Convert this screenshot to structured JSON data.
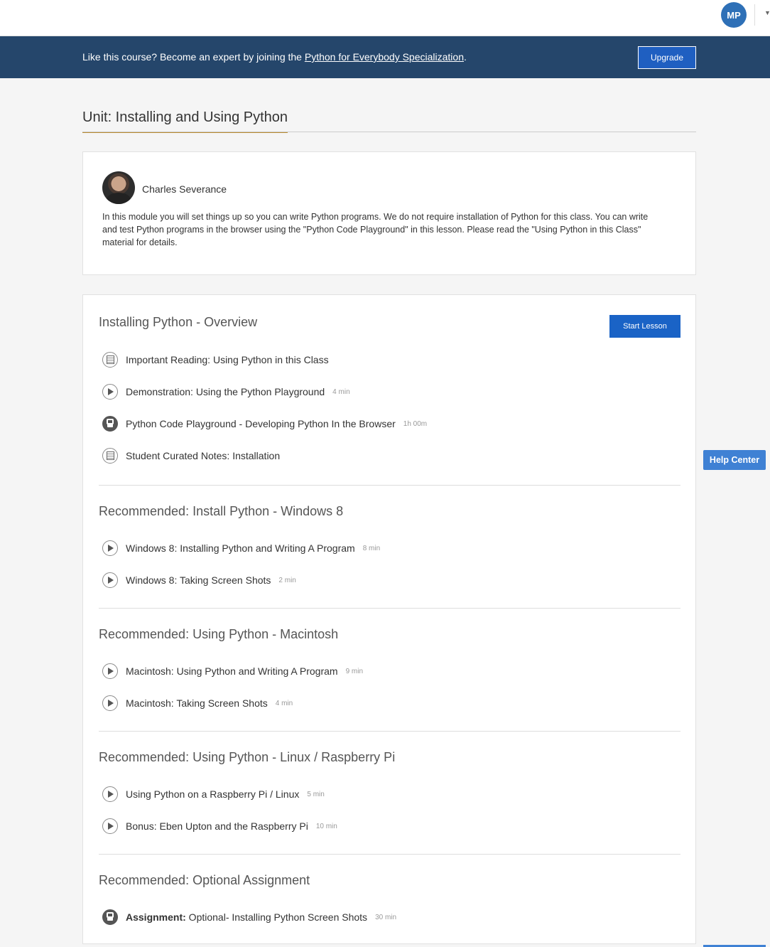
{
  "header": {
    "avatar_initials": "MP"
  },
  "banner": {
    "text_before": "Like this course? Become an expert by joining the ",
    "link_text": "Python for Everybody Specialization",
    "text_after": ".",
    "upgrade_label": "Upgrade"
  },
  "unit": {
    "title": "Unit: Installing and Using Python"
  },
  "intro": {
    "author": "Charles Severance",
    "description": "In this module you will set things up so you can write Python programs. We do not require installation of Python for this class. You can write and test Python programs in the browser using the \"Python Code Playground\" in this lesson. Please read the \"Using Python in this Class\" material for details."
  },
  "lessons": {
    "start_label": "Start Lesson",
    "sections": [
      {
        "title": "Installing Python - Overview",
        "items": [
          {
            "icon": "reading-icon",
            "label": "Important Reading: Using Python in this Class",
            "duration": ""
          },
          {
            "icon": "play-icon",
            "label": "Demonstration: Using the Python Playground",
            "duration": "4 min"
          },
          {
            "icon": "lock-icon",
            "label": "Python Code Playground - Developing Python In the Browser",
            "duration": "1h 00m"
          },
          {
            "icon": "reading-icon",
            "label": "Student Curated Notes: Installation",
            "duration": ""
          }
        ]
      },
      {
        "title": "Recommended: Install Python - Windows 8",
        "items": [
          {
            "icon": "play-icon",
            "label": "Windows 8: Installing Python and Writing A Program",
            "duration": "8 min"
          },
          {
            "icon": "play-icon",
            "label": "Windows 8: Taking Screen Shots",
            "duration": "2 min"
          }
        ]
      },
      {
        "title": "Recommended: Using Python - Macintosh",
        "items": [
          {
            "icon": "play-icon",
            "label": "Macintosh: Using Python and Writing A Program",
            "duration": "9 min"
          },
          {
            "icon": "play-icon",
            "label": "Macintosh: Taking Screen Shots",
            "duration": "4 min"
          }
        ]
      },
      {
        "title": "Recommended: Using Python - Linux / Raspberry Pi",
        "items": [
          {
            "icon": "play-icon",
            "label": "Using Python on a Raspberry Pi / Linux",
            "duration": "5 min"
          },
          {
            "icon": "play-icon",
            "label": "Bonus: Eben Upton and the Raspberry Pi",
            "duration": "10 min"
          }
        ]
      },
      {
        "title": "Recommended: Optional Assignment",
        "items": [
          {
            "icon": "lock-icon",
            "label_bold": "Assignment:",
            "label": " Optional- Installing Python Screen Shots",
            "duration": "30 min"
          }
        ]
      }
    ]
  },
  "help": {
    "label": "Help Center"
  },
  "colors": {
    "banner_bg": "#25466b",
    "primary_button": "#1a63c6",
    "avatar_bg": "#2e70b7",
    "title_underline": "#b88a2e",
    "help_button": "#3f81d4"
  }
}
